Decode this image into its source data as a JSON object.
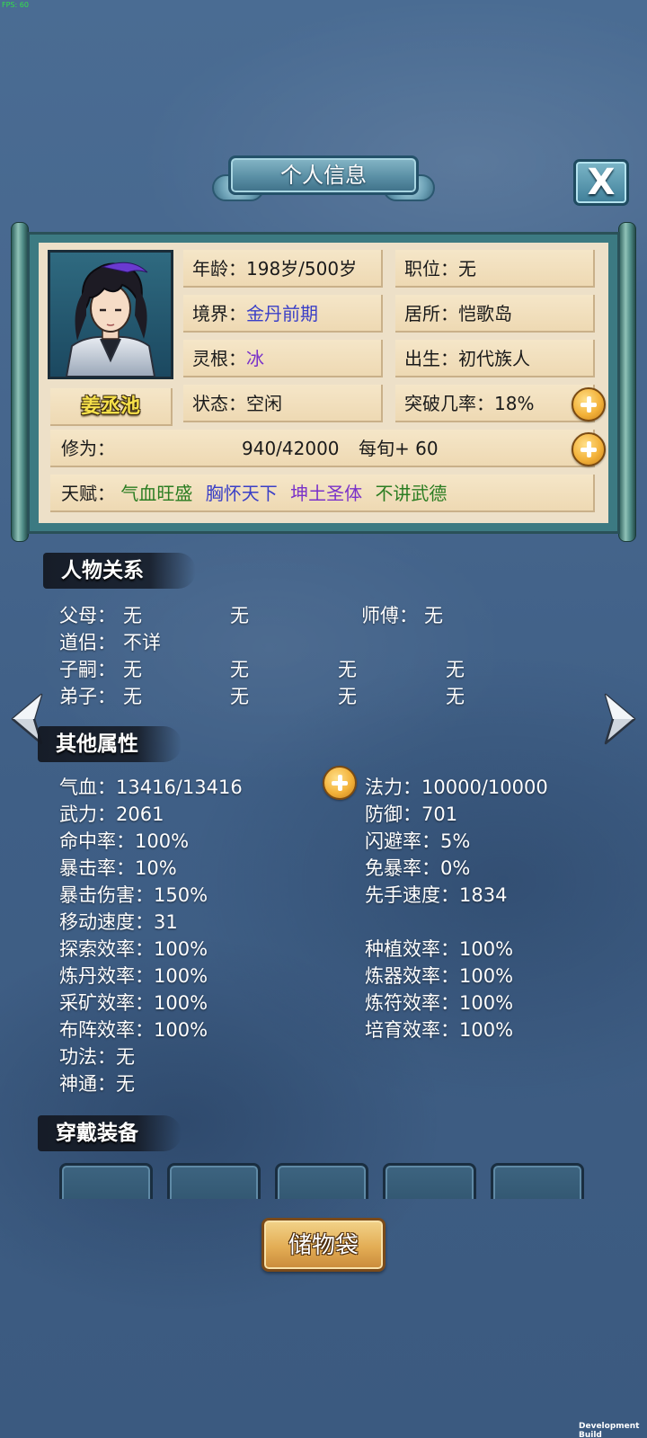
{
  "overlay": {
    "fps": "FPS: 60"
  },
  "header": {
    "title": "个人信息",
    "close_label": "X"
  },
  "profile": {
    "name": "姜丞池",
    "age": {
      "label": "年龄：",
      "value": "198岁/500岁"
    },
    "position": {
      "label": "职位：",
      "value": "无"
    },
    "realm": {
      "label": "境界：",
      "value": "金丹前期"
    },
    "residence": {
      "label": "居所：",
      "value": "恺歌岛"
    },
    "spirit_root": {
      "label": "灵根：",
      "value": "冰"
    },
    "birth": {
      "label": "出生：",
      "value": "初代族人"
    },
    "status": {
      "label": "状态：",
      "value": "空闲"
    },
    "breakthrough": {
      "label": "突破几率：",
      "value": "18%"
    },
    "cultivation": {
      "label": "修为：",
      "value": "940/42000",
      "rate": "每旬+ 60"
    },
    "talents": {
      "label": "天赋：",
      "items": [
        "气血旺盛",
        "胸怀天下",
        "坤土圣体",
        "不讲武德"
      ]
    }
  },
  "relations": {
    "title": "人物关系",
    "parents_label": "父母：",
    "parents": [
      "无",
      "无"
    ],
    "master_label": "师傅：",
    "master": "无",
    "partner_label": "道侣：",
    "partner": "不详",
    "children_label": "子嗣：",
    "children": [
      "无",
      "无",
      "无",
      "无"
    ],
    "disciples_label": "弟子：",
    "disciples": [
      "无",
      "无",
      "无",
      "无"
    ]
  },
  "attributes": {
    "title": "其他属性",
    "left": [
      "气血：13416/13416",
      "武力：2061",
      "命中率：100%",
      "暴击率：10%",
      "暴击伤害：150%",
      "移动速度：31",
      "探索效率：100%",
      "炼丹效率：100%",
      "采矿效率：100%",
      "布阵效率：100%",
      "功法：无",
      "神通：无"
    ],
    "right": [
      "法力：10000/10000",
      "防御：701",
      "闪避率：5%",
      "免暴率：0%",
      "先手速度：1834",
      "种植效率：100%",
      "炼器效率：100%",
      "炼符效率：100%",
      "培育效率：100%"
    ]
  },
  "equipment": {
    "title": "穿戴装备",
    "slots": [
      "",
      "",
      "",
      "",
      ""
    ]
  },
  "storage_button": "储物袋",
  "footer": {
    "dev_build": "Development Build"
  },
  "colors": {
    "talent_1": "#2b7d22",
    "talent_2": "#3a3fc7",
    "talent_3": "#7a32c9",
    "talent_4": "#2b7d22",
    "realm_value": "#3a3fc7",
    "spirit_root_value": "#7a32c9"
  }
}
